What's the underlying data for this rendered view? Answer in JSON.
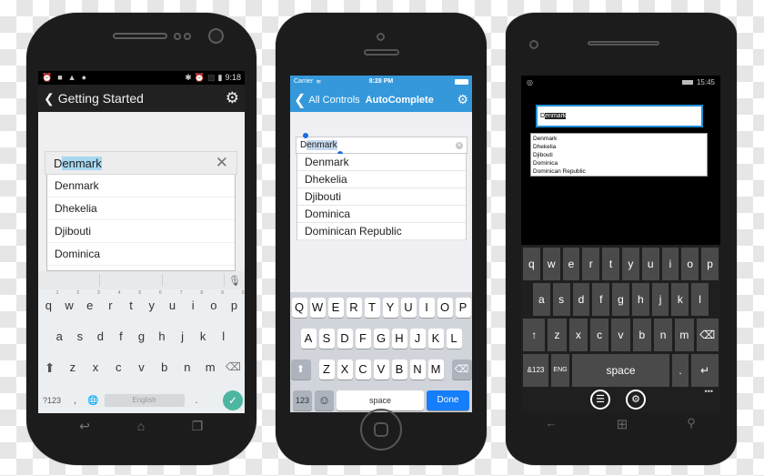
{
  "android": {
    "status": {
      "left_icons": [
        "alarm-icon",
        "square-icon",
        "app-icon",
        "android-icon"
      ],
      "right_icons": [
        "bluetooth-icon",
        "alarm-icon",
        "no-sim-icon",
        "battery-icon"
      ],
      "time": "9:18"
    },
    "toolbar": {
      "back": "❮",
      "title": "Getting Started",
      "settings": "⚙"
    },
    "input": {
      "typed": "D",
      "selected": "enmark",
      "clear": "✕"
    },
    "suggestions": [
      "Denmark",
      "Dhekelia",
      "Djibouti",
      "Dominica"
    ],
    "keyboard": {
      "row1": [
        {
          "k": "q",
          "n": "1"
        },
        {
          "k": "w",
          "n": "2"
        },
        {
          "k": "e",
          "n": "3"
        },
        {
          "k": "r",
          "n": "4"
        },
        {
          "k": "t",
          "n": "5"
        },
        {
          "k": "y",
          "n": "6"
        },
        {
          "k": "u",
          "n": "7"
        },
        {
          "k": "i",
          "n": "8"
        },
        {
          "k": "o",
          "n": "9"
        },
        {
          "k": "p",
          "n": "0"
        }
      ],
      "row2": [
        "a",
        "s",
        "d",
        "f",
        "g",
        "h",
        "j",
        "k",
        "l"
      ],
      "row3": [
        "z",
        "x",
        "c",
        "v",
        "b",
        "n",
        "m"
      ],
      "shift": "⬆",
      "backspace": "⌫",
      "symbols": "?123",
      "comma": ",",
      "globe": "🌐",
      "space": "English",
      "period": ".",
      "done": "✓"
    },
    "nav": {
      "back": "↩",
      "home": "⌂",
      "recents": "❐"
    }
  },
  "iphone": {
    "status": {
      "carrier": "Carrier",
      "wifi": "≋",
      "time": "8:28 PM"
    },
    "nav": {
      "back": "❮",
      "back_label": "All Controls",
      "title": "AutoComplete",
      "settings": "⚙"
    },
    "input": {
      "typed": "D",
      "selected": "enmark",
      "clear": "✕"
    },
    "suggestions": [
      "Denmark",
      "Dhekelia",
      "Djibouti",
      "Dominica",
      "Dominican Republic"
    ],
    "keyboard": {
      "row1": [
        "Q",
        "W",
        "E",
        "R",
        "T",
        "Y",
        "U",
        "I",
        "O",
        "P"
      ],
      "row2": [
        "A",
        "S",
        "D",
        "F",
        "G",
        "H",
        "J",
        "K",
        "L"
      ],
      "row3": [
        "Z",
        "X",
        "C",
        "V",
        "B",
        "N",
        "M"
      ],
      "shift": "⬆",
      "backspace": "⌫",
      "numbers": "123",
      "emoji": "☺",
      "space": "space",
      "done": "Done"
    }
  },
  "windows": {
    "status": {
      "left_icon": "location-icon",
      "time": "15:45"
    },
    "input": {
      "typed": "D",
      "selected": "enmark"
    },
    "suggestions": [
      "Denmark",
      "Dhekelia",
      "Djibouti",
      "Dominica",
      "Dominican Republic"
    ],
    "keyboard": {
      "row1": [
        "q",
        "w",
        "e",
        "r",
        "t",
        "y",
        "u",
        "i",
        "o",
        "p"
      ],
      "row2": [
        "a",
        "s",
        "d",
        "f",
        "g",
        "h",
        "j",
        "k",
        "l"
      ],
      "row3": [
        "z",
        "x",
        "c",
        "v",
        "b",
        "n",
        "m"
      ],
      "shift": "↑",
      "backspace": "⌫",
      "symbols": "&123",
      "lang": "ENG",
      "space": "space",
      "period": ".",
      "enter": "↵",
      "list_btn": "☰",
      "settings_btn": "⚙",
      "more": "•••"
    },
    "nav": {
      "back": "←",
      "start": "⊞",
      "search": "⚲"
    }
  },
  "colors": {
    "ios_blue": "#3498db",
    "ios_done": "#157efb",
    "android_accent": "#4db6a0",
    "win_accent": "#1e90d6"
  }
}
